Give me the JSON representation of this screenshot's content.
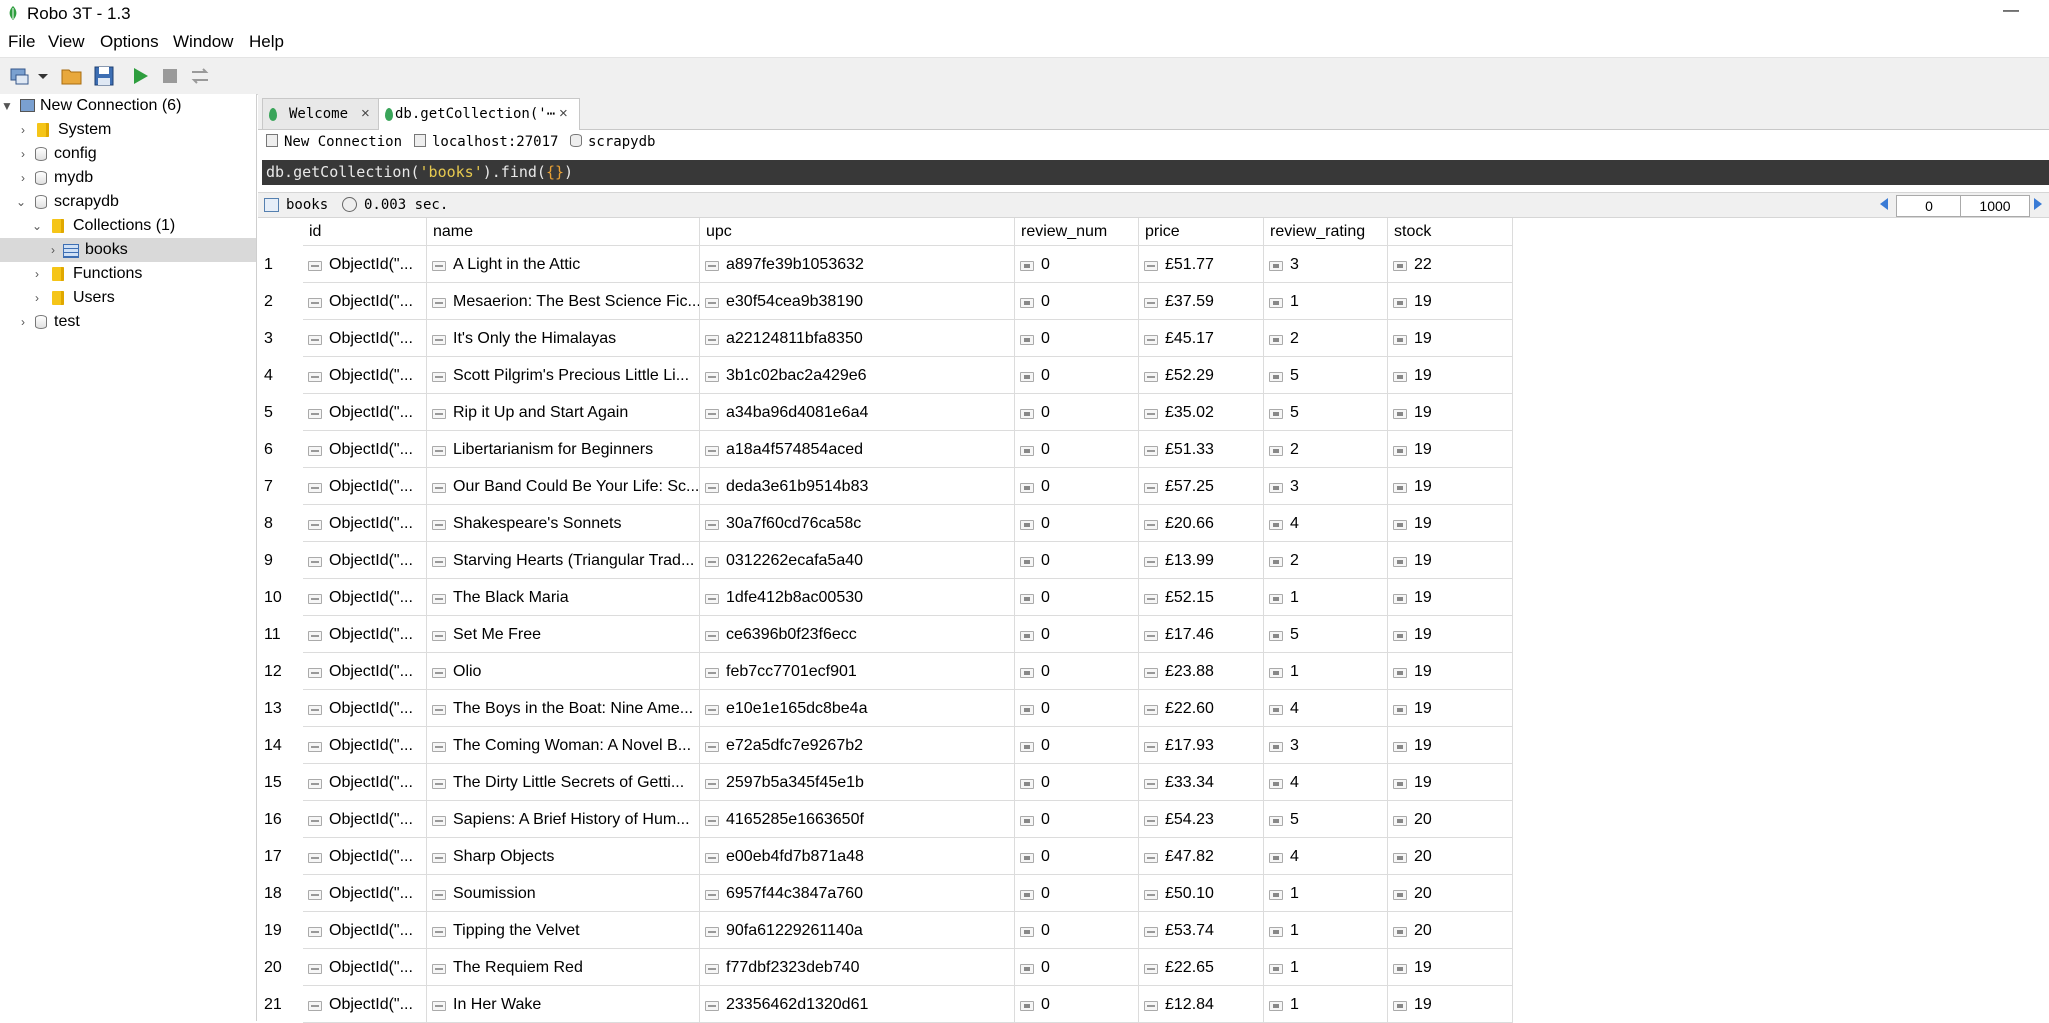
{
  "app": {
    "title": "Robo 3T - 1.3",
    "minimize": "—"
  },
  "menu": [
    "File",
    "View",
    "Options",
    "Window",
    "Help"
  ],
  "toolbar": {
    "icons": [
      "connect-icon",
      "dropdown-arrow-icon",
      "open-folder-icon",
      "save-icon",
      "execute-icon",
      "stop-icon",
      "refresh-icon"
    ],
    "colors": {
      "execute": "#2e9e3e",
      "stop": "#9a9a9a"
    }
  },
  "sidebar": {
    "connection": "New Connection (6)",
    "items": [
      {
        "label": "System",
        "icon": "folder-icon"
      },
      {
        "label": "config",
        "icon": "database-icon"
      },
      {
        "label": "mydb",
        "icon": "database-icon"
      },
      {
        "label": "scrapydb",
        "icon": "database-icon"
      },
      {
        "label": "Collections (1)",
        "icon": "folder-icon"
      },
      {
        "label": "books",
        "icon": "collection-icon"
      },
      {
        "label": "Functions",
        "icon": "folder-icon"
      },
      {
        "label": "Users",
        "icon": "folder-icon"
      },
      {
        "label": "test",
        "icon": "database-icon"
      }
    ]
  },
  "tabs": [
    {
      "label": "Welcome",
      "close": "×"
    },
    {
      "label": "db.getCollection('⋯",
      "close": "×"
    }
  ],
  "conninfo": {
    "connection": "New Connection",
    "host": "localhost:27017",
    "db": "scrapydb"
  },
  "query": {
    "prefix": "db.getCollection(",
    "str": "'books'",
    "mid": ").find(",
    "braces": "{}",
    "end": ")"
  },
  "result": {
    "collection": "books",
    "time": "0.003 sec.",
    "skip": "0",
    "limit": "1000"
  },
  "columns": [
    "id",
    "name",
    "upc",
    "review_num",
    "price",
    "review_rating",
    "stock"
  ],
  "rows": [
    {
      "n": "1",
      "id": "ObjectId(\"...",
      "name": "A Light in the Attic",
      "upc": "a897fe39b1053632",
      "review_num": "0",
      "price": "£51.77",
      "review_rating": "3",
      "stock": "22"
    },
    {
      "n": "2",
      "id": "ObjectId(\"...",
      "name": "Mesaerion: The Best Science Fic...",
      "upc": "e30f54cea9b38190",
      "review_num": "0",
      "price": "£37.59",
      "review_rating": "1",
      "stock": "19"
    },
    {
      "n": "3",
      "id": "ObjectId(\"...",
      "name": "It's Only the Himalayas",
      "upc": "a22124811bfa8350",
      "review_num": "0",
      "price": "£45.17",
      "review_rating": "2",
      "stock": "19"
    },
    {
      "n": "4",
      "id": "ObjectId(\"...",
      "name": "Scott Pilgrim's Precious Little Li...",
      "upc": "3b1c02bac2a429e6",
      "review_num": "0",
      "price": "£52.29",
      "review_rating": "5",
      "stock": "19"
    },
    {
      "n": "5",
      "id": "ObjectId(\"...",
      "name": "Rip it Up and Start Again",
      "upc": "a34ba96d4081e6a4",
      "review_num": "0",
      "price": "£35.02",
      "review_rating": "5",
      "stock": "19"
    },
    {
      "n": "6",
      "id": "ObjectId(\"...",
      "name": "Libertarianism for Beginners",
      "upc": "a18a4f574854aced",
      "review_num": "0",
      "price": "£51.33",
      "review_rating": "2",
      "stock": "19"
    },
    {
      "n": "7",
      "id": "ObjectId(\"...",
      "name": "Our Band Could Be Your Life: Sc...",
      "upc": "deda3e61b9514b83",
      "review_num": "0",
      "price": "£57.25",
      "review_rating": "3",
      "stock": "19"
    },
    {
      "n": "8",
      "id": "ObjectId(\"...",
      "name": "Shakespeare's Sonnets",
      "upc": "30a7f60cd76ca58c",
      "review_num": "0",
      "price": "£20.66",
      "review_rating": "4",
      "stock": "19"
    },
    {
      "n": "9",
      "id": "ObjectId(\"...",
      "name": "Starving Hearts (Triangular Trad...",
      "upc": "0312262ecafa5a40",
      "review_num": "0",
      "price": "£13.99",
      "review_rating": "2",
      "stock": "19"
    },
    {
      "n": "10",
      "id": "ObjectId(\"...",
      "name": "The Black Maria",
      "upc": "1dfe412b8ac00530",
      "review_num": "0",
      "price": "£52.15",
      "review_rating": "1",
      "stock": "19"
    },
    {
      "n": "11",
      "id": "ObjectId(\"...",
      "name": "Set Me Free",
      "upc": "ce6396b0f23f6ecc",
      "review_num": "0",
      "price": "£17.46",
      "review_rating": "5",
      "stock": "19"
    },
    {
      "n": "12",
      "id": "ObjectId(\"...",
      "name": "Olio",
      "upc": "feb7cc7701ecf901",
      "review_num": "0",
      "price": "£23.88",
      "review_rating": "1",
      "stock": "19"
    },
    {
      "n": "13",
      "id": "ObjectId(\"...",
      "name": "The Boys in the Boat: Nine Ame...",
      "upc": "e10e1e165dc8be4a",
      "review_num": "0",
      "price": "£22.60",
      "review_rating": "4",
      "stock": "19"
    },
    {
      "n": "14",
      "id": "ObjectId(\"...",
      "name": "The Coming Woman: A Novel B...",
      "upc": "e72a5dfc7e9267b2",
      "review_num": "0",
      "price": "£17.93",
      "review_rating": "3",
      "stock": "19"
    },
    {
      "n": "15",
      "id": "ObjectId(\"...",
      "name": "The Dirty Little Secrets of Getti...",
      "upc": "2597b5a345f45e1b",
      "review_num": "0",
      "price": "£33.34",
      "review_rating": "4",
      "stock": "19"
    },
    {
      "n": "16",
      "id": "ObjectId(\"...",
      "name": "Sapiens: A Brief History of Hum...",
      "upc": "4165285e1663650f",
      "review_num": "0",
      "price": "£54.23",
      "review_rating": "5",
      "stock": "20"
    },
    {
      "n": "17",
      "id": "ObjectId(\"...",
      "name": "Sharp Objects",
      "upc": "e00eb4fd7b871a48",
      "review_num": "0",
      "price": "£47.82",
      "review_rating": "4",
      "stock": "20"
    },
    {
      "n": "18",
      "id": "ObjectId(\"...",
      "name": "Soumission",
      "upc": "6957f44c3847a760",
      "review_num": "0",
      "price": "£50.10",
      "review_rating": "1",
      "stock": "20"
    },
    {
      "n": "19",
      "id": "ObjectId(\"...",
      "name": "Tipping the Velvet",
      "upc": "90fa61229261140a",
      "review_num": "0",
      "price": "£53.74",
      "review_rating": "1",
      "stock": "20"
    },
    {
      "n": "20",
      "id": "ObjectId(\"...",
      "name": "The Requiem Red",
      "upc": "f77dbf2323deb740",
      "review_num": "0",
      "price": "£22.65",
      "review_rating": "1",
      "stock": "19"
    },
    {
      "n": "21",
      "id": "ObjectId(\"...",
      "name": "In Her Wake",
      "upc": "23356462d1320d61",
      "review_num": "0",
      "price": "£12.84",
      "review_rating": "1",
      "stock": "19"
    }
  ]
}
